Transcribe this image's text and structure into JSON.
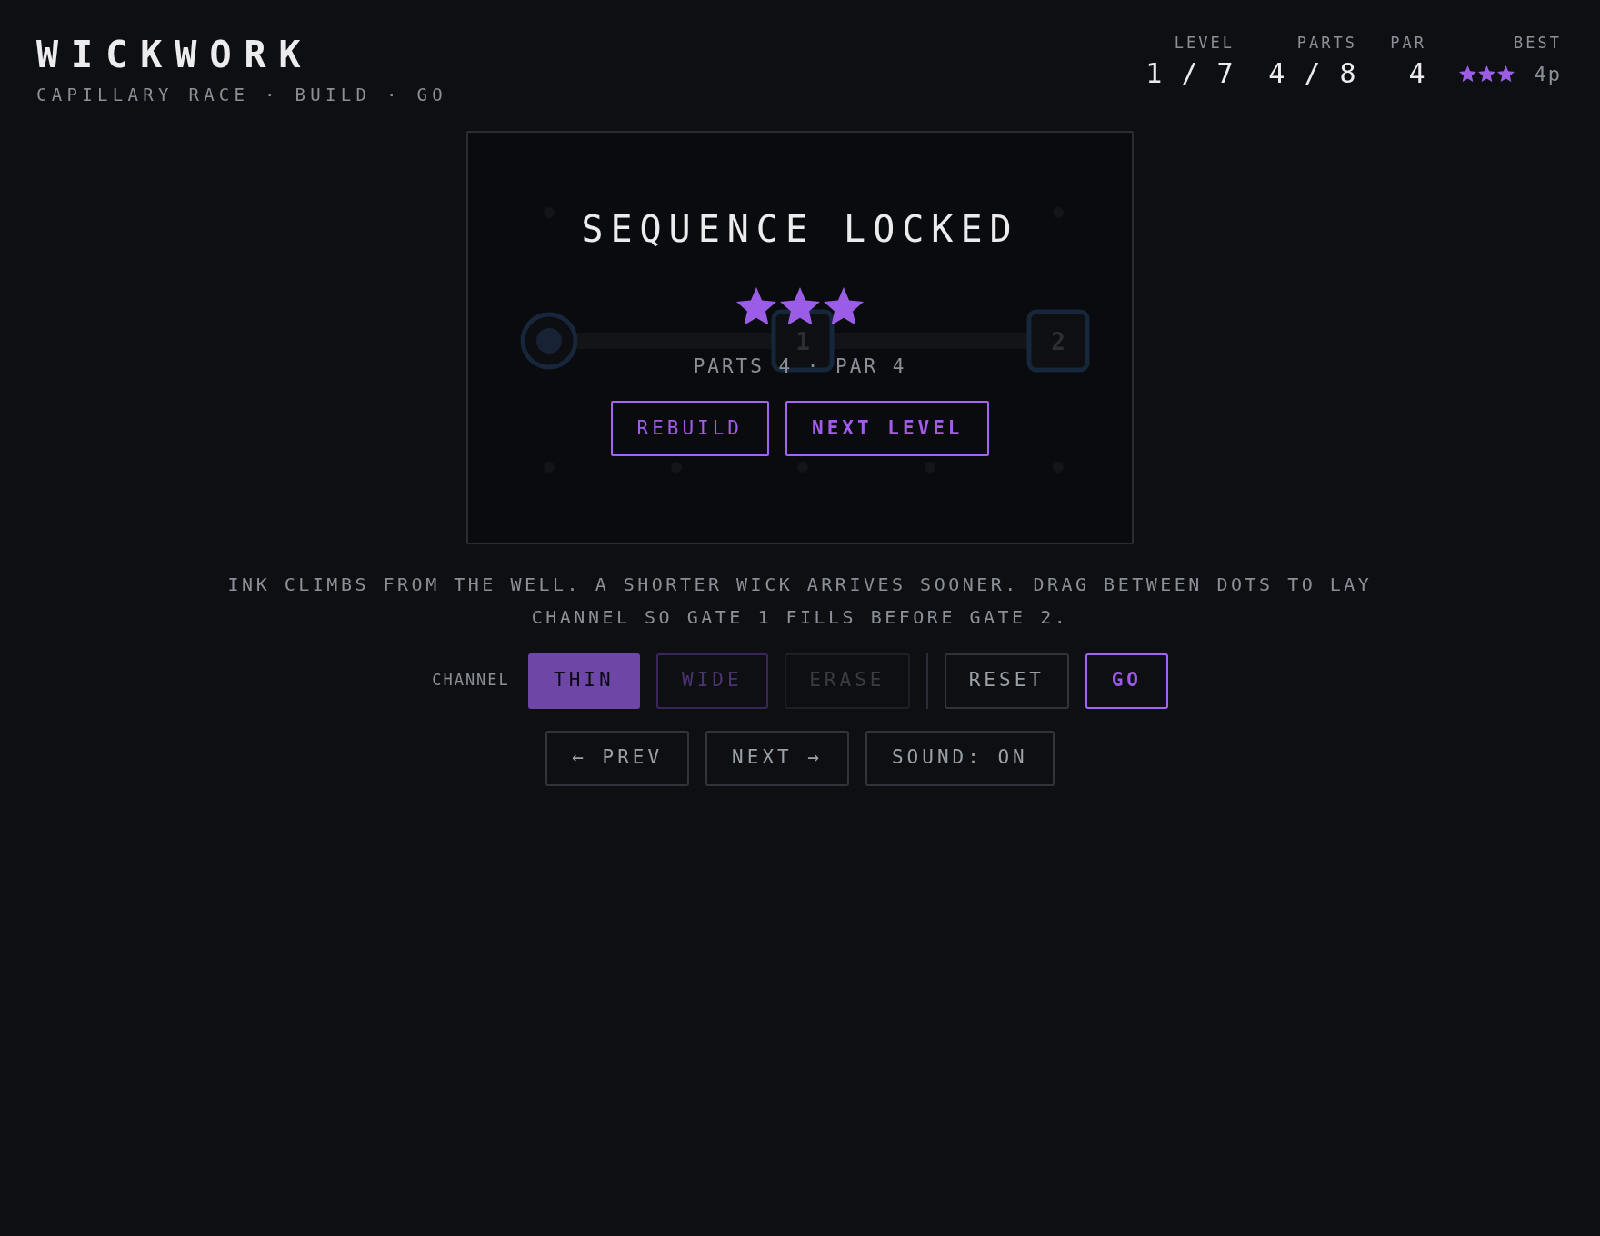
{
  "app": {
    "title": "WICKWORK",
    "subtitle": "CAPILLARY RACE · BUILD · GO"
  },
  "hud": [
    {
      "label": "LEVEL",
      "value": "1 / 7"
    },
    {
      "label": "PARTS",
      "value": "4 / 8"
    },
    {
      "label": "PAR",
      "value": "4"
    }
  ],
  "best": {
    "label": "BEST",
    "stars": 3,
    "value": "4p"
  },
  "board": {
    "gates": [
      {
        "label": "1"
      },
      {
        "label": "2"
      }
    ]
  },
  "result": {
    "title": "SEQUENCE LOCKED",
    "stars": 3,
    "summary": "PARTS 4 · PAR 4",
    "buttons": [
      {
        "label": "REBUILD",
        "kind": "secondary"
      },
      {
        "label": "NEXT LEVEL",
        "kind": "primary"
      }
    ]
  },
  "instructions": "INK CLIMBS FROM THE WELL. A SHORTER WICK ARRIVES SOONER. DRAG BETWEEN DOTS TO LAY CHANNEL SO GATE 1 FILLS BEFORE GATE 2.",
  "toolbar": {
    "label": "CHANNEL",
    "tools": [
      {
        "label": "THIN",
        "kind": "brush",
        "selected": true
      },
      {
        "label": "WIDE",
        "kind": "brush",
        "selected": false
      },
      {
        "label": "ERASE",
        "kind": "erase",
        "selected": false
      }
    ],
    "actions": [
      {
        "label": "RESET",
        "kind": "secondary"
      },
      {
        "label": "GO",
        "kind": "primary"
      }
    ]
  },
  "nav": [
    {
      "label": "← PREV"
    },
    {
      "label": "NEXT →"
    },
    {
      "label": "SOUND: ON"
    }
  ]
}
